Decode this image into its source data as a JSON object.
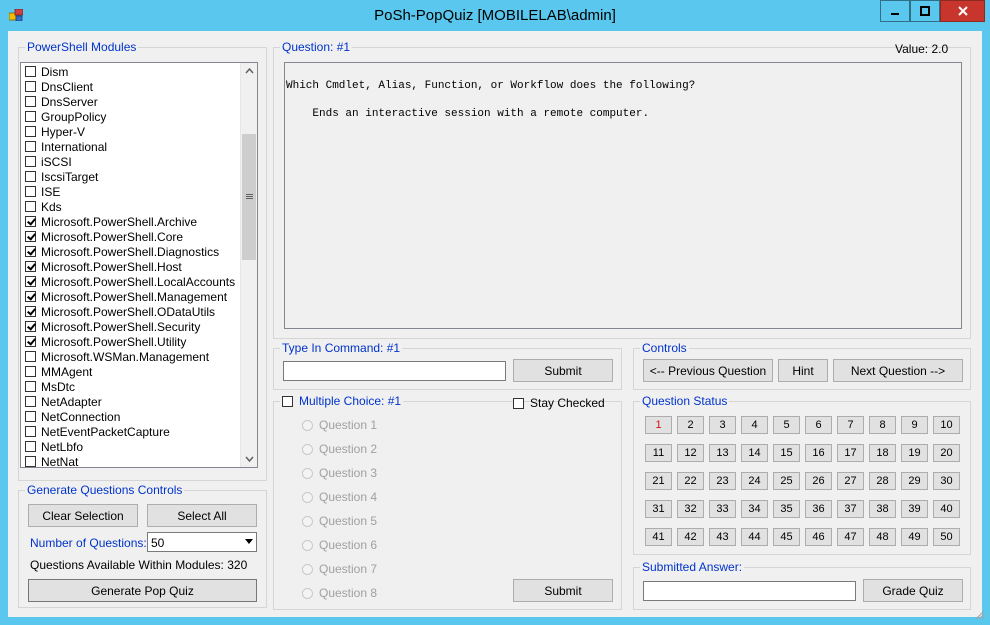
{
  "window": {
    "title": "PoSh-PopQuiz   [MOBILELAB\\admin]",
    "icons": {
      "app": "app-icon",
      "minimize": "minimize-icon",
      "maximize": "maximize-icon",
      "close": "close-icon"
    }
  },
  "modules": {
    "legend": "PowerShell Modules",
    "items": [
      {
        "label": "Dism",
        "checked": false
      },
      {
        "label": "DnsClient",
        "checked": false
      },
      {
        "label": "DnsServer",
        "checked": false
      },
      {
        "label": "GroupPolicy",
        "checked": false
      },
      {
        "label": "Hyper-V",
        "checked": false
      },
      {
        "label": "International",
        "checked": false
      },
      {
        "label": "iSCSI",
        "checked": false
      },
      {
        "label": "IscsiTarget",
        "checked": false
      },
      {
        "label": "ISE",
        "checked": false
      },
      {
        "label": "Kds",
        "checked": false
      },
      {
        "label": "Microsoft.PowerShell.Archive",
        "checked": true
      },
      {
        "label": "Microsoft.PowerShell.Core",
        "checked": true
      },
      {
        "label": "Microsoft.PowerShell.Diagnostics",
        "checked": true
      },
      {
        "label": "Microsoft.PowerShell.Host",
        "checked": true
      },
      {
        "label": "Microsoft.PowerShell.LocalAccounts",
        "checked": true
      },
      {
        "label": "Microsoft.PowerShell.Management",
        "checked": true
      },
      {
        "label": "Microsoft.PowerShell.ODataUtils",
        "checked": true
      },
      {
        "label": "Microsoft.PowerShell.Security",
        "checked": true
      },
      {
        "label": "Microsoft.PowerShell.Utility",
        "checked": true
      },
      {
        "label": "Microsoft.WSMan.Management",
        "checked": false
      },
      {
        "label": "MMAgent",
        "checked": false
      },
      {
        "label": "MsDtc",
        "checked": false
      },
      {
        "label": "NetAdapter",
        "checked": false
      },
      {
        "label": "NetConnection",
        "checked": false
      },
      {
        "label": "NetEventPacketCapture",
        "checked": false
      },
      {
        "label": "NetLbfo",
        "checked": false
      },
      {
        "label": "NetNat",
        "checked": false
      }
    ]
  },
  "generate": {
    "legend": "Generate Questions Controls",
    "clear_label": "Clear Selection",
    "select_all_label": "Select All",
    "num_questions_label": "Number of Questions:",
    "num_questions_value": "50",
    "available_text": "Questions Available Within Modules: 320",
    "generate_label": "Generate Pop Quiz"
  },
  "question": {
    "legend": "Question: #1",
    "value_text": "Value:  2.0",
    "line1": "Which Cmdlet, Alias, Function, or Workflow does the following?",
    "line2": "    Ends an interactive session with a remote computer."
  },
  "type_in": {
    "legend": "Type In Command: #1",
    "input_value": "",
    "submit_label": "Submit"
  },
  "controls": {
    "legend": "Controls",
    "prev_label": "<-- Previous Question",
    "hint_label": "Hint",
    "next_label": "Next Question -->"
  },
  "multiple_choice": {
    "legend": "Multiple Choice: #1",
    "enabled": false,
    "stay_checked_label": "Stay Checked",
    "stay_checked": false,
    "options": [
      "Question 1",
      "Question 2",
      "Question 3",
      "Question 4",
      "Question 5",
      "Question 6",
      "Question 7",
      "Question 8"
    ],
    "submit_label": "Submit"
  },
  "status": {
    "legend": "Question Status",
    "current": 1,
    "numbers": [
      "1",
      "2",
      "3",
      "4",
      "5",
      "6",
      "7",
      "8",
      "9",
      "10",
      "11",
      "12",
      "13",
      "14",
      "15",
      "16",
      "17",
      "18",
      "19",
      "20",
      "21",
      "22",
      "23",
      "24",
      "25",
      "26",
      "27",
      "28",
      "29",
      "30",
      "31",
      "32",
      "33",
      "34",
      "35",
      "36",
      "37",
      "38",
      "39",
      "40",
      "41",
      "42",
      "43",
      "44",
      "45",
      "46",
      "47",
      "48",
      "49",
      "50"
    ],
    "current_color": "#d21414"
  },
  "submitted": {
    "legend": "Submitted Answer:",
    "input_value": "",
    "grade_label": "Grade Quiz"
  },
  "colors": {
    "titlebar": "#5ac8ee",
    "legend_text": "#0033cc",
    "close_button": "#c7352c"
  }
}
